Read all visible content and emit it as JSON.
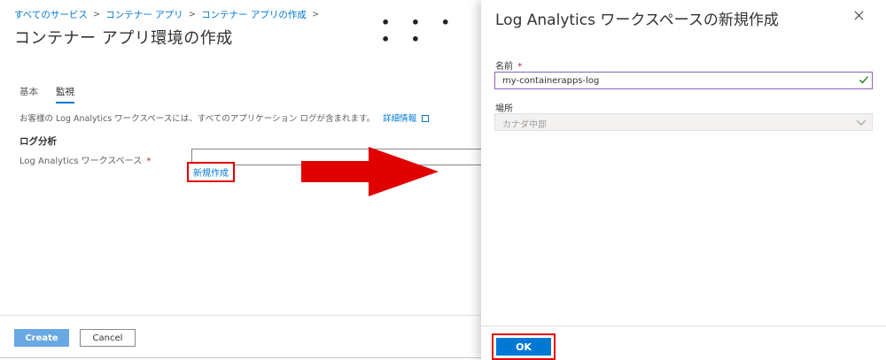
{
  "breadcrumb": [
    "すべてのサービス",
    "コンテナー アプリ",
    "コンテナー アプリの作成"
  ],
  "page": {
    "title": "コンテナー アプリ環境の作成",
    "more_label": "…",
    "dots": "• • • • •"
  },
  "tabs": [
    {
      "label": "基本",
      "active": false
    },
    {
      "label": "監視",
      "active": true
    }
  ],
  "monitoring": {
    "description": "お客様の Log Analytics ワークスペースには、すべてのアプリケーション ログが含まれます。",
    "learn_more": "詳細情報",
    "section_title": "ログ分析",
    "workspace_label": "Log Analytics ワークスペース",
    "required_mark": "*",
    "workspace_value": "",
    "create_new": "新規作成"
  },
  "footer": {
    "create_label": "Create",
    "cancel_label": "Cancel"
  },
  "panel": {
    "title": "Log Analytics ワークスペースの新規作成",
    "name_label": "名前",
    "required_mark": "*",
    "name_value": "my-containerapps-log",
    "location_label": "場所",
    "location_value": "カナダ中部",
    "ok_label": "OK"
  },
  "colors": {
    "accent": "#0078d4",
    "highlight": "#e00000",
    "input_focus": "#8764b8",
    "valid": "#107c10"
  },
  "icons": [
    "chevron-right-icon",
    "external-link-icon",
    "close-icon",
    "checkmark-icon",
    "chevron-down-icon",
    "red-arrow-icon"
  ]
}
